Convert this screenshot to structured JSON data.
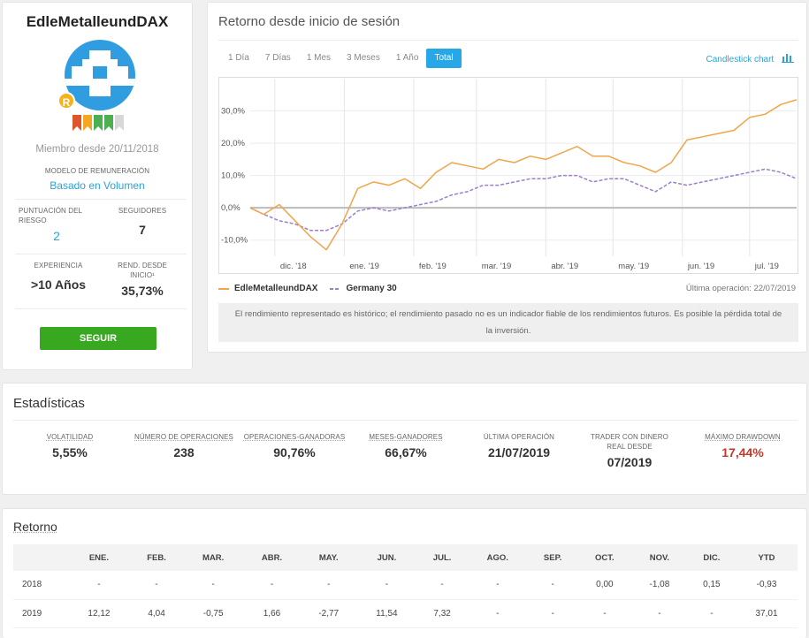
{
  "profile": {
    "username": "EdleMetalleundDAX",
    "badge": "R",
    "ribbon_colors": [
      "#e0542a",
      "#f5a623",
      "#4caf50",
      "#4caf50",
      "#d8d8d8"
    ],
    "member_since": "Miembro desde 20/11/2018",
    "model_label": "MODELO DE REMUNERACIÓN",
    "model_value": "Basado en Volumen",
    "risk_label": "PUNTUACIÓN DEL RIESGO",
    "risk_value": "2",
    "followers_label": "SEGUIDORES",
    "followers_value": "7",
    "experience_label": "EXPERIENCIA",
    "experience_value": ">10 Años",
    "return_label": "REND. DESDE INICIO¹",
    "return_value": "35,73%",
    "follow_button": "SEGUIR"
  },
  "chart_card": {
    "title": "Retorno desde inicio de sesión",
    "tabs": [
      "1 Día",
      "7 Días",
      "1 Mes",
      "3 Meses",
      "1 Año",
      "Total"
    ],
    "active_tab": "Total",
    "candlestick_label": "Candlestick chart",
    "last_operation": "Última operación: 22/07/2019",
    "disclaimer": "El rendimiento representado es histórico; el rendimiento pasado no es un indicador fiable de los rendimientos futuros. Es posible la pérdida total de la inversión."
  },
  "chart_data": {
    "type": "line",
    "x": [
      "2018-11-20",
      "2018-11-26",
      "2018-12-03",
      "2018-12-10",
      "2018-12-17",
      "2018-12-24",
      "2018-12-31",
      "2019-01-07",
      "2019-01-14",
      "2019-01-21",
      "2019-01-28",
      "2019-02-04",
      "2019-02-11",
      "2019-02-18",
      "2019-02-25",
      "2019-03-04",
      "2019-03-11",
      "2019-03-18",
      "2019-03-25",
      "2019-04-01",
      "2019-04-08",
      "2019-04-15",
      "2019-04-22",
      "2019-04-29",
      "2019-05-06",
      "2019-05-13",
      "2019-05-20",
      "2019-05-27",
      "2019-06-03",
      "2019-06-10",
      "2019-06-17",
      "2019-06-24",
      "2019-07-01",
      "2019-07-08",
      "2019-07-15",
      "2019-07-22"
    ],
    "series": [
      {
        "name": "EdleMetalleundDAX",
        "color": "#f0a54a",
        "values": [
          0,
          -2,
          1,
          -4,
          -9,
          -13,
          -5,
          6,
          8,
          7,
          9,
          6,
          11,
          14,
          13,
          12,
          15,
          14,
          16,
          15,
          17,
          19,
          16,
          16,
          14,
          13,
          11,
          14,
          21,
          22,
          23,
          24,
          28,
          29,
          32,
          33.5
        ]
      },
      {
        "name": "Germany 30",
        "color": "#9b7fc8",
        "values": [
          0,
          -2,
          -4,
          -5,
          -7,
          -7,
          -5,
          -1,
          0,
          -1,
          0,
          1,
          2,
          4,
          5,
          7,
          7,
          8,
          9,
          9,
          10,
          10,
          8,
          9,
          9,
          7,
          5,
          8,
          7,
          8,
          9,
          10,
          11,
          12,
          11,
          9
        ]
      }
    ],
    "x_tick_labels": [
      "dic. '18",
      "ene. '19",
      "feb. '19",
      "mar. '19",
      "abr. '19",
      "may. '19",
      "jun. '19",
      "jul. '19"
    ],
    "y_ticks": [
      -10,
      0,
      10,
      20,
      30
    ],
    "y_tick_labels": [
      "-10,0%",
      "0,0%",
      "10,0%",
      "20,0%",
      "30,0%"
    ],
    "ylim": [
      -15,
      40
    ],
    "grid": true,
    "legend_position": "bottom-left"
  },
  "stats": {
    "title": "Estadísticas",
    "items": [
      {
        "label": "VOLATILIDAD",
        "value": "5,55%",
        "color": "#333333"
      },
      {
        "label": "NÚMERO DE OPERACIONES",
        "value": "238",
        "color": "#333333"
      },
      {
        "label": "OPERACIONES-GANADORAS",
        "value": "90,76%",
        "color": "#333333"
      },
      {
        "label": "MESES-GANADORES",
        "value": "66,67%",
        "color": "#333333"
      },
      {
        "label": "ÚLTIMA OPERACIÓN",
        "value": "21/07/2019",
        "color": "#333333"
      },
      {
        "label": "TRADER CON DINERO REAL DESDE",
        "value": "07/2019",
        "color": "#333333"
      },
      {
        "label": "MÁXIMO DRAWDOWN",
        "value": "17,44%",
        "color": "#c0392b"
      }
    ]
  },
  "returns": {
    "title": "Retorno",
    "headers": [
      "",
      "ENE.",
      "FEB.",
      "MAR.",
      "ABR.",
      "MAY.",
      "JUN.",
      "JUL.",
      "AGO.",
      "SEP.",
      "OCT.",
      "NOV.",
      "DIC.",
      "YTD"
    ],
    "rows": [
      [
        "2018",
        "-",
        "-",
        "-",
        "-",
        "-",
        "-",
        "-",
        "-",
        "-",
        "0,00",
        "-1,08",
        "0,15",
        "-0,93"
      ],
      [
        "2019",
        "12,12",
        "4,04",
        "-0,75",
        "1,66",
        "-2,77",
        "11,54",
        "7,32",
        "-",
        "-",
        "-",
        "-",
        "-",
        "37,01"
      ]
    ]
  }
}
